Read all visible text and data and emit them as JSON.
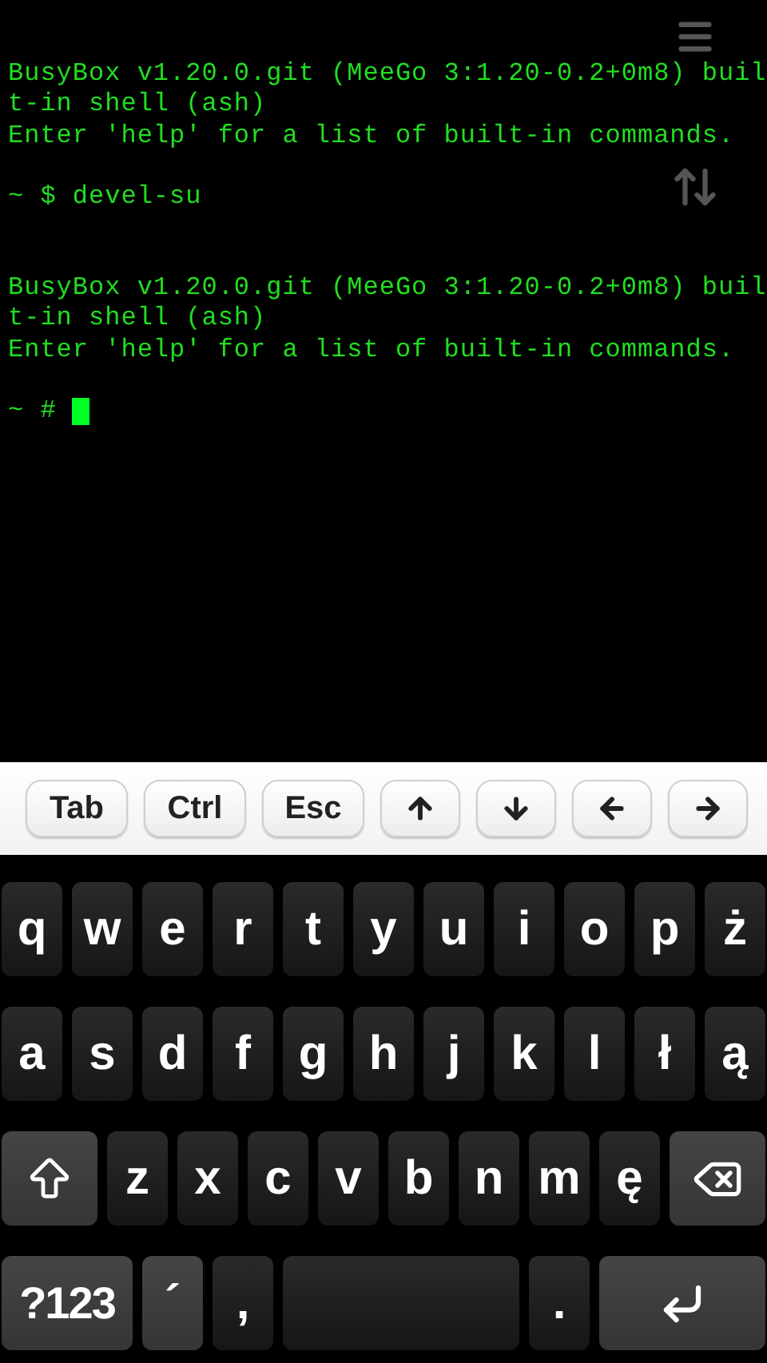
{
  "terminal": {
    "blocks": [
      {
        "lines": [
          "BusyBox v1.20.0.git (MeeGo 3:1.20-0.2+0m8) buil",
          "t-in shell (ash)",
          "Enter 'help' for a list of built-in commands."
        ]
      },
      {
        "lines": [
          "~ $ devel-su"
        ]
      },
      {
        "lines": [
          "BusyBox v1.20.0.git (MeeGo 3:1.20-0.2+0m8) buil",
          "t-in shell (ash)",
          "Enter 'help' for a list of built-in commands."
        ]
      },
      {
        "lines": [
          "~ # "
        ],
        "cursor": true
      }
    ]
  },
  "toolbar": {
    "keys": [
      {
        "kind": "text",
        "label": "Tab"
      },
      {
        "kind": "text",
        "label": "Ctrl"
      },
      {
        "kind": "text",
        "label": "Esc"
      },
      {
        "kind": "up"
      },
      {
        "kind": "down"
      },
      {
        "kind": "left"
      },
      {
        "kind": "right"
      }
    ]
  },
  "keyboard": {
    "rows": [
      {
        "keys": [
          {
            "kind": "letter",
            "label": "q"
          },
          {
            "kind": "letter",
            "label": "w"
          },
          {
            "kind": "letter",
            "label": "e"
          },
          {
            "kind": "letter",
            "label": "r"
          },
          {
            "kind": "letter",
            "label": "t"
          },
          {
            "kind": "letter",
            "label": "y"
          },
          {
            "kind": "letter",
            "label": "u"
          },
          {
            "kind": "letter",
            "label": "i"
          },
          {
            "kind": "letter",
            "label": "o"
          },
          {
            "kind": "letter",
            "label": "p"
          },
          {
            "kind": "letter",
            "label": "ż"
          }
        ]
      },
      {
        "keys": [
          {
            "kind": "letter",
            "label": "a"
          },
          {
            "kind": "letter",
            "label": "s"
          },
          {
            "kind": "letter",
            "label": "d"
          },
          {
            "kind": "letter",
            "label": "f"
          },
          {
            "kind": "letter",
            "label": "g"
          },
          {
            "kind": "letter",
            "label": "h"
          },
          {
            "kind": "letter",
            "label": "j"
          },
          {
            "kind": "letter",
            "label": "k"
          },
          {
            "kind": "letter",
            "label": "l"
          },
          {
            "kind": "letter",
            "label": "ł"
          },
          {
            "kind": "letter",
            "label": "ą"
          }
        ]
      },
      {
        "keys": [
          {
            "kind": "shift"
          },
          {
            "kind": "letter",
            "label": "z"
          },
          {
            "kind": "letter",
            "label": "x"
          },
          {
            "kind": "letter",
            "label": "c"
          },
          {
            "kind": "letter",
            "label": "v"
          },
          {
            "kind": "letter",
            "label": "b"
          },
          {
            "kind": "letter",
            "label": "n"
          },
          {
            "kind": "letter",
            "label": "m"
          },
          {
            "kind": "letter",
            "label": "ę"
          },
          {
            "kind": "backspace"
          }
        ]
      },
      {
        "keys": [
          {
            "kind": "symbols",
            "label": "?123"
          },
          {
            "kind": "accent",
            "label": "´"
          },
          {
            "kind": "letter",
            "label": ","
          },
          {
            "kind": "space"
          },
          {
            "kind": "letter",
            "label": "."
          },
          {
            "kind": "enter"
          }
        ]
      }
    ]
  }
}
